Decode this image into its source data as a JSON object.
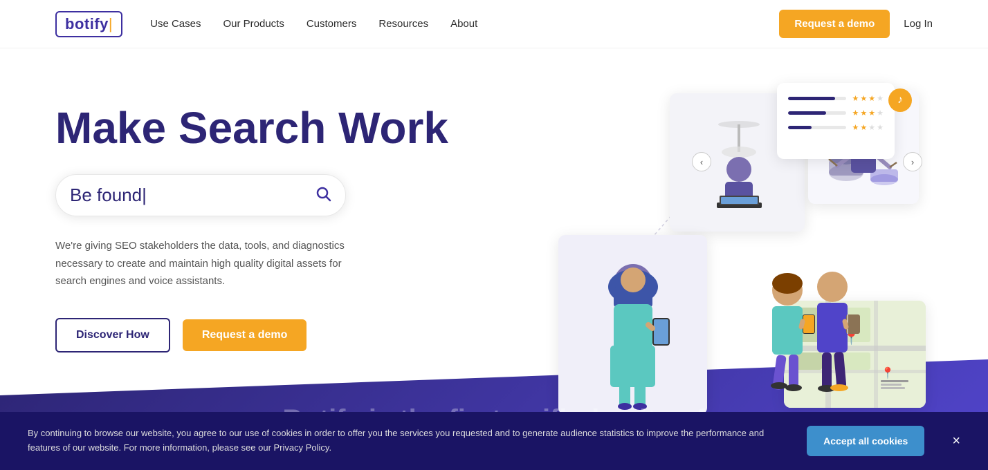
{
  "brand": {
    "name": "botify",
    "cursor": "|"
  },
  "nav": {
    "links": [
      {
        "label": "Use Cases",
        "id": "use-cases"
      },
      {
        "label": "Our Products",
        "id": "our-products"
      },
      {
        "label": "Customers",
        "id": "customers"
      },
      {
        "label": "Resources",
        "id": "resources"
      },
      {
        "label": "About",
        "id": "about"
      }
    ],
    "cta_demo": "Request a demo",
    "cta_login": "Log In"
  },
  "hero": {
    "title": "Make Search Work",
    "search_placeholder": "Be found",
    "search_cursor": "|",
    "description": "We're giving SEO stakeholders the data, tools, and diagnostics necessary to create and maintain high quality digital assets for search engines and voice assistants.",
    "btn_discover": "Discover How",
    "btn_demo": "Request a demo"
  },
  "cookie": {
    "message": "By continuing to browse our website, you agree to our use of cookies in order to offer you the services you requested and to generate audience statistics to improve the performance and features of our website. For more information, please see our Privacy Policy.",
    "privacy_link": "Privacy Policy",
    "accept_label": "Accept all cookies",
    "close_symbol": "×"
  },
  "wave": {
    "text": "Botify is the first unified suite of"
  },
  "colors": {
    "primary": "#2d2575",
    "accent": "#f5a623",
    "blue_btn": "#3d8fcc",
    "dark_bg": "#1a1464"
  }
}
